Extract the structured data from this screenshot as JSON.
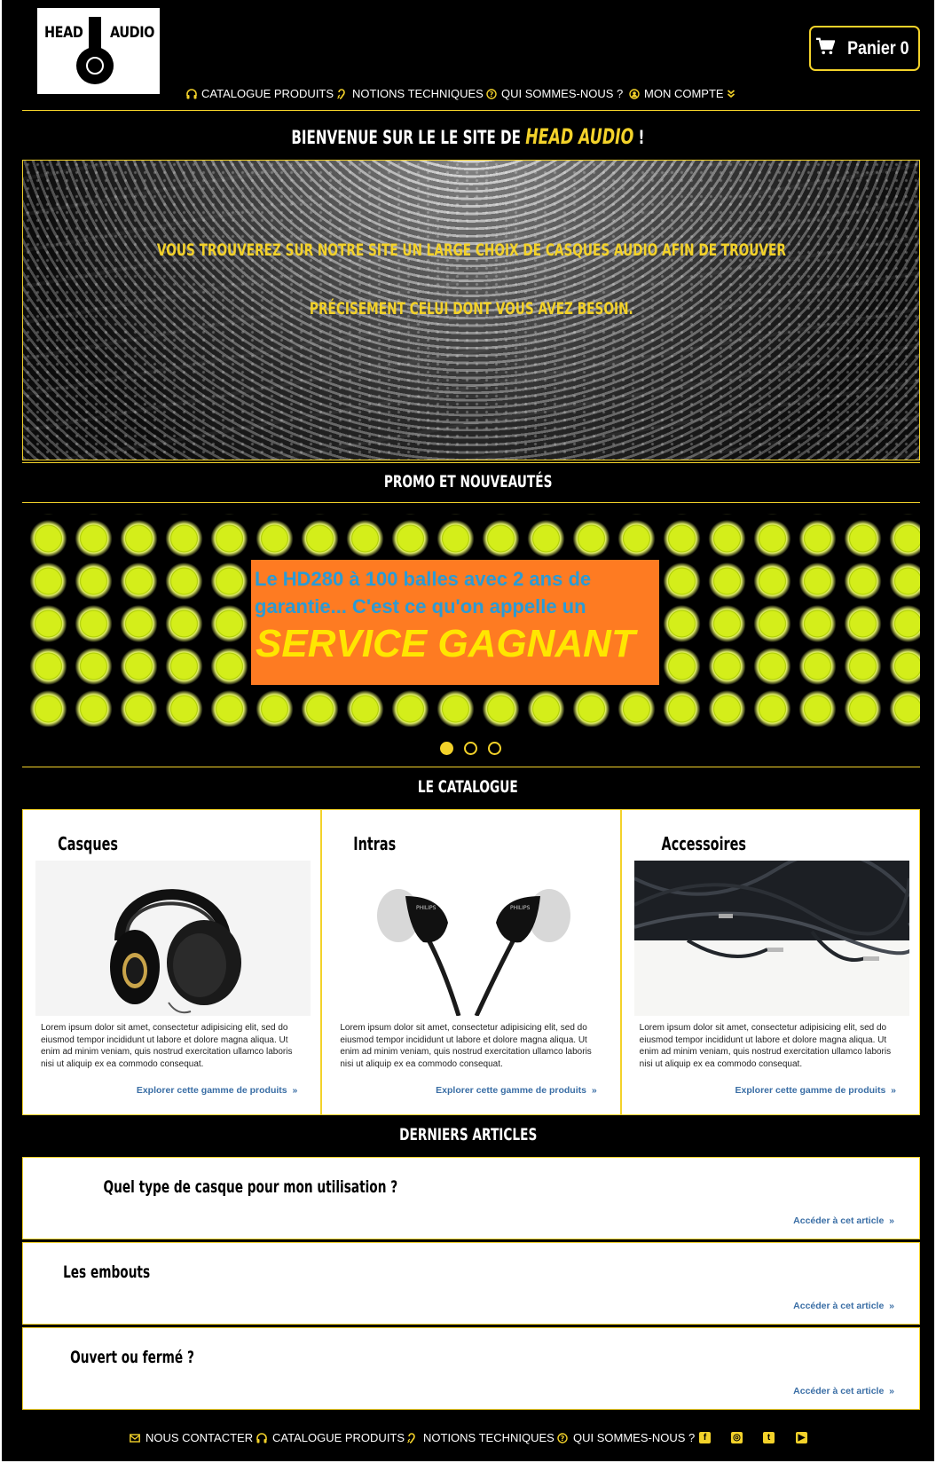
{
  "logo": {
    "word1": "HEAD",
    "word2": "AUDIO"
  },
  "cart": {
    "label": "Panier 0",
    "icon": "cart-icon"
  },
  "nav": [
    {
      "label": "CATALOGUE PRODUITS",
      "icon": "headphones-icon"
    },
    {
      "label": "NOTIONS TECHNIQUES",
      "icon": "ear-icon"
    },
    {
      "label": "QUI SOMMES-NOUS ?",
      "icon": "question-circle-icon"
    },
    {
      "label": "MON COMPTE",
      "icon": "user-circle-icon",
      "dropdown_icon": "double-chevron-down-icon"
    }
  ],
  "welcome": {
    "prefix": "BIENVENUE SUR LE LE SITE DE ",
    "brand": "HEAD AUDIO",
    "suffix": " !"
  },
  "hero": {
    "line1": "VOUS TROUVEREZ SUR NOTRE SITE UN LARGE CHOIX DE CASQUES AUDIO AFIN DE TROUVER",
    "line2": "PRÉCISEMENT CELUI DONT VOUS AVEZ BESOIN."
  },
  "promo_title": "PROMO ET NOUVEAUTÉS",
  "promo": {
    "text": "Le HD280 à 100 balles avec 2 ans de garantie... C'est ce qu'on appelle un",
    "headline": "SERVICE GAGNANT",
    "slides": 3,
    "active_slide": 1
  },
  "catalogue_title": "LE CATALOGUE",
  "catalogue": [
    {
      "title": "Casques",
      "desc": "Lorem ipsum dolor sit amet, consectetur adipisicing elit, sed do eiusmod tempor incididunt ut labore et dolore magna aliqua. Ut enim ad minim veniam, quis nostrud exercitation ullamco laboris nisi ut aliquip ex ea commodo consequat.",
      "link": "Explorer cette gamme de produits"
    },
    {
      "title": "Intras",
      "desc": "Lorem ipsum dolor sit amet, consectetur adipisicing elit, sed do eiusmod tempor incididunt ut labore et dolore magna aliqua. Ut enim ad minim veniam, quis nostrud exercitation ullamco laboris nisi ut aliquip ex ea commodo consequat.",
      "link": "Explorer cette gamme de produits"
    },
    {
      "title": "Accessoires",
      "desc": "Lorem ipsum dolor sit amet, consectetur adipisicing elit, sed do eiusmod tempor incididunt ut labore et dolore magna aliqua. Ut enim ad minim veniam, quis nostrud exercitation ullamco laboris nisi ut aliquip ex ea commodo consequat.",
      "link": "Explorer cette gamme de produits"
    }
  ],
  "articles_title": "DERNIERS ARTICLES",
  "articles": [
    {
      "title": "Quel type de casque pour mon utilisation ?",
      "link": "Accéder à cet article"
    },
    {
      "title": "Les embouts",
      "link": "Accéder à cet article"
    },
    {
      "title": "Ouvert ou fermé ?",
      "link": "Accéder à cet article"
    }
  ],
  "footer": [
    {
      "label": "NOUS CONTACTER",
      "icon": "envelope-icon"
    },
    {
      "label": "CATALOGUE PRODUITS",
      "icon": "headphones-icon"
    },
    {
      "label": "NOTIONS TECHNIQUES",
      "icon": "ear-icon"
    },
    {
      "label": "QUI SOMMES-NOUS ?",
      "icon": "question-circle-icon"
    }
  ],
  "social": [
    "facebook-icon",
    "instagram-icon",
    "twitter-icon",
    "youtube-icon"
  ],
  "colors": {
    "accent": "#f3d22a",
    "promo_box": "#fe7b22",
    "promo_text": "#2a9bd6",
    "promo_headline": "#ffe600",
    "link": "#3a6ea5"
  }
}
